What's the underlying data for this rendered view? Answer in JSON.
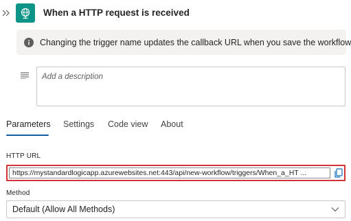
{
  "header": {
    "title": "When a HTTP request is received",
    "collapse_icon": "double-chevron-right-icon",
    "trigger_icon": "globe-request-icon",
    "accent_color": "#0d9488"
  },
  "info_bar": {
    "icon": "info-icon",
    "message": "Changing the trigger name updates the callback URL when you save the workflow."
  },
  "description": {
    "icon": "lines-icon",
    "placeholder": "Add a description",
    "value": ""
  },
  "tabs": [
    {
      "label": "Parameters",
      "active": true
    },
    {
      "label": "Settings",
      "active": false
    },
    {
      "label": "Code view",
      "active": false
    },
    {
      "label": "About",
      "active": false
    }
  ],
  "http_url": {
    "label": "HTTP URL",
    "value": "https://mystandardlogicapp.azurewebsites.net:443/api/new-workflow/triggers/When_a_HT ...",
    "copy_icon": "copy-icon",
    "highlight_color": "#d13438"
  },
  "method": {
    "label": "Method",
    "selected": "Default (Allow All Methods)",
    "chevron_icon": "chevron-down-icon"
  }
}
